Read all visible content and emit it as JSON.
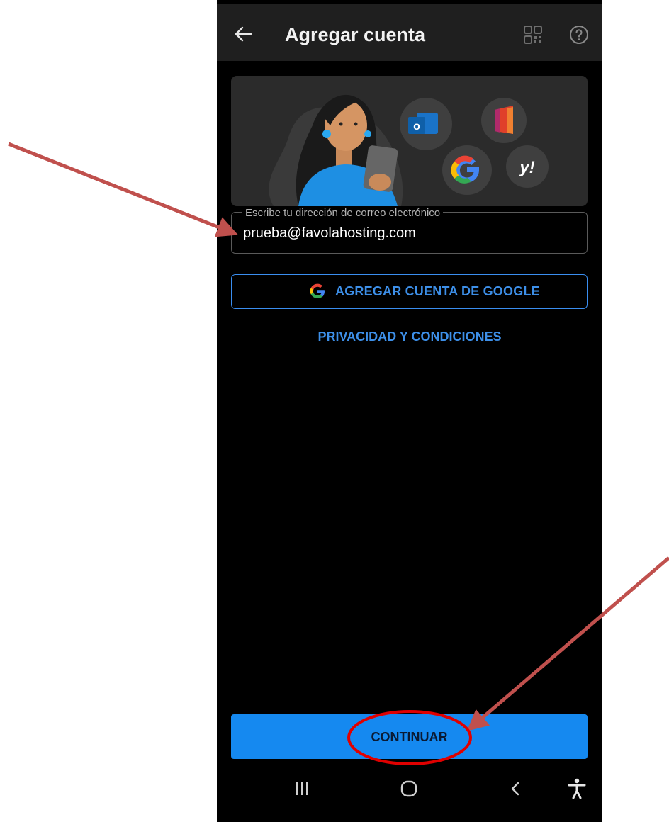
{
  "app_bar": {
    "title": "Agregar cuenta",
    "icons": [
      "back-arrow-icon",
      "qr-code-icon",
      "help-icon"
    ]
  },
  "hero": {
    "illustration": "woman-with-phone-and-provider-logos",
    "provider_icons": [
      "outlook-icon",
      "office-icon",
      "google-icon",
      "yahoo-icon"
    ],
    "yahoo_text": "y!"
  },
  "email_field": {
    "label": "Escribe tu dirección de correo electrónico",
    "value": "prueba@favolahosting.com"
  },
  "google_button": {
    "label": "AGREGAR CUENTA DE GOOGLE",
    "icon": "google-icon"
  },
  "privacy_link": {
    "label": "PRIVACIDAD Y CONDICIONES"
  },
  "continue_button": {
    "label": "CONTINUAR"
  },
  "system_nav": {
    "icons": [
      "recents-icon",
      "home-icon",
      "back-icon",
      "accessibility-icon"
    ]
  },
  "annotations": {
    "arrow_color": "#c0504d",
    "circle_color": "#e00000"
  },
  "colors": {
    "accent": "#1589f0",
    "link": "#3d8fe8",
    "background": "#000000",
    "app_bar": "#1f1f1f"
  }
}
